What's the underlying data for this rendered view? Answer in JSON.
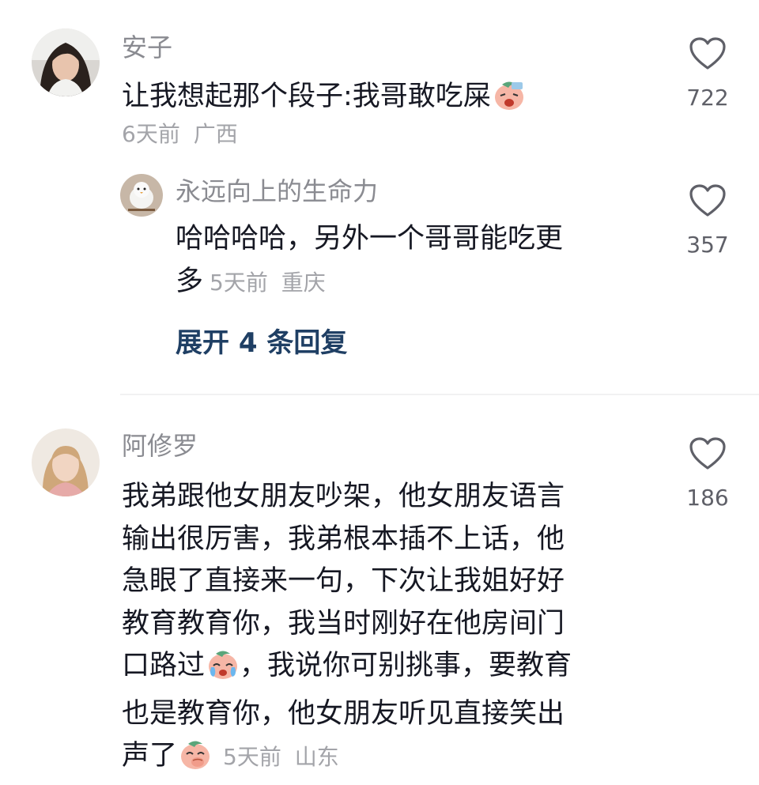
{
  "comments": [
    {
      "username": "安子",
      "text": "让我想起那个段子:我哥敢吃屎",
      "emoji": "peach-facepalm-emoji",
      "time": "6天前",
      "location": "广西",
      "likes": "722",
      "replies": [
        {
          "username": "永远向上的生命力",
          "text_line1": "哈哈哈哈，另外一个哥哥能吃更",
          "text_line2": "多",
          "time": "5天前",
          "location": "重庆",
          "likes": "357"
        }
      ],
      "expand_label": "展开 4 条回复"
    },
    {
      "username": "阿修罗",
      "lines": [
        "我弟跟他女朋友吵架，他女朋友语言",
        "输出很厉害，我弟根本插不上话，他",
        "急眼了直接来一句，下次让我姐好好",
        "教育教育你，我当时刚好在他房间门",
        "口路过",
        "，我说你可别挑事，要教育",
        "也是教育你，他女朋友听见直接笑出",
        "声了"
      ],
      "emojis": [
        "peach-crying-emoji",
        "peach-giggle-emoji"
      ],
      "time": "5天前",
      "location": "山东",
      "likes": "186"
    }
  ],
  "colors": {
    "username": "#8a8b91",
    "text": "#161823",
    "meta": "#a3a4a9",
    "link": "#1f3f64",
    "heart": "#5f6068"
  }
}
